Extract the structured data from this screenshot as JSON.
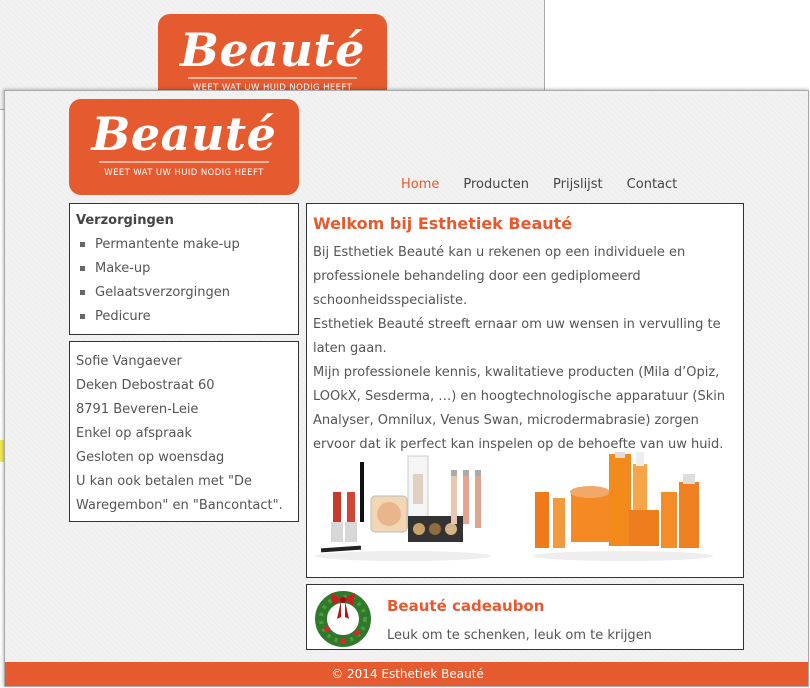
{
  "brand": {
    "name": "Beauté",
    "tagline": "WEET WAT UW HUID NODIG HEEFT",
    "color": "#e55a2e"
  },
  "nav": [
    {
      "label": "Home",
      "active": true
    },
    {
      "label": "Producten",
      "active": false
    },
    {
      "label": "Prijslijst",
      "active": false
    },
    {
      "label": "Contact",
      "active": false
    }
  ],
  "menu": {
    "title": "Verzorgingen",
    "items": [
      "Permantente make-up",
      "Make-up",
      "Gelaatsverzorgingen",
      "Pedicure"
    ]
  },
  "contact": {
    "lines": [
      "Sofie Vangaever",
      "Deken Debostraat 60",
      "8791 Beveren-Leie",
      "Enkel op afspraak",
      "Gesloten op woensdag",
      "U kan ook betalen met \"De Waregembon\" en \"Bancontact\"."
    ]
  },
  "main": {
    "title": "Welkom bij Esthetiek Beauté",
    "paragraphs": [
      "Bij Esthetiek Beauté kan u rekenen op een individuele en professionele behandeling door een gediplomeerd schoonheidsspecialiste.",
      "Esthetiek Beauté streeft ernaar om uw wensen in vervulling te laten gaan.",
      "Mijn professionele kennis, kwalitatieve producten (Mila d’Opiz, LOOkX, Sesderma, …) en hoogtechnologische apparatuur (Skin Analyser, Omnilux, Venus Swan, microdermabrasie) zorgen ervoor dat ik perfect kan inspelen op de behoefte van uw huid."
    ],
    "images": [
      "makeup-products-image",
      "skincare-products-image"
    ]
  },
  "gift": {
    "title": "Beauté cadeaubon",
    "text": "Leuk om te schenken, leuk om te krijgen",
    "icon": "christmas-wreath-icon"
  },
  "footer": {
    "text": "© 2014 Esthetiek Beauté"
  }
}
